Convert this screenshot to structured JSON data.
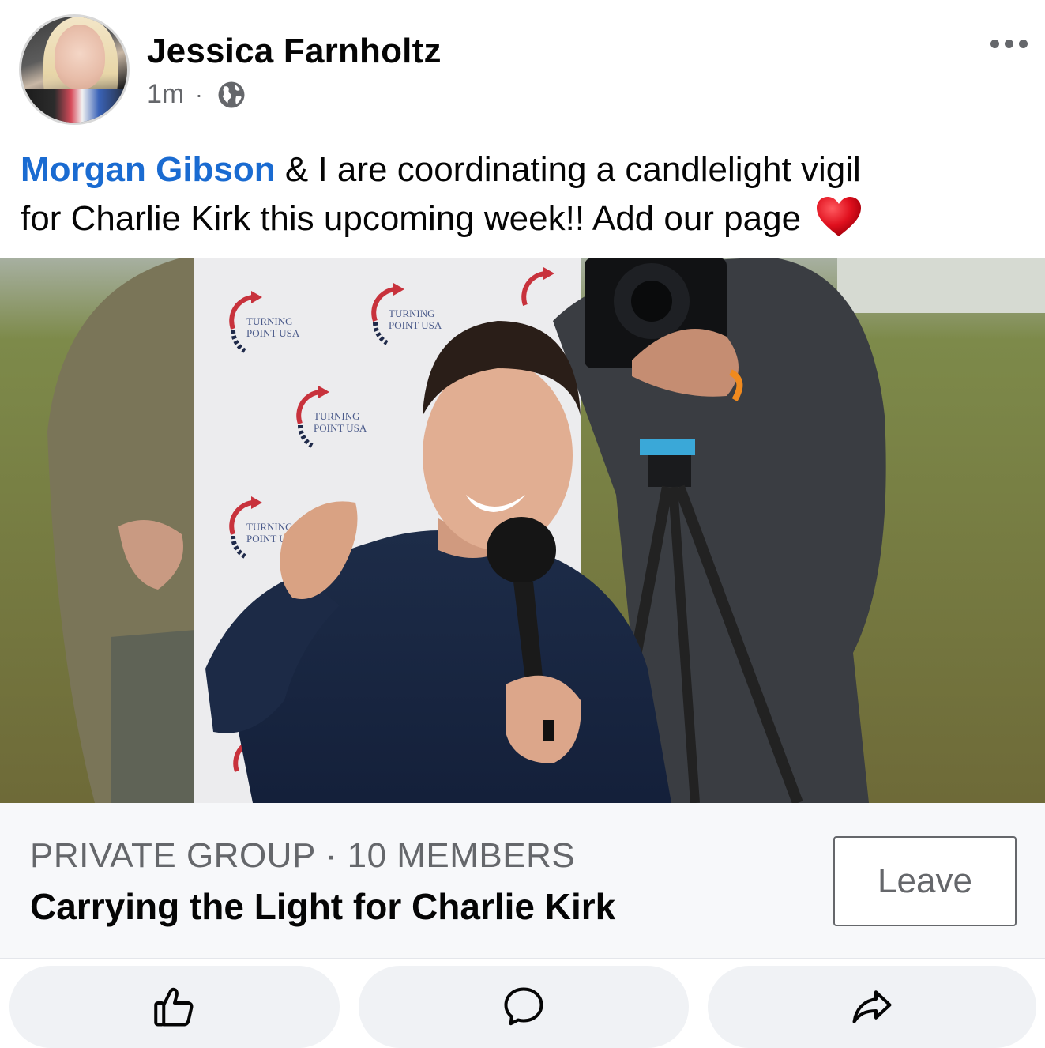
{
  "post": {
    "author": "Jessica Farnholtz",
    "timestamp": "1m",
    "separator": "·",
    "audience_icon": "globe-icon",
    "more_icon": "more-options-icon",
    "mention": "Morgan Gibson",
    "text_line1": " & I are coordinating a candlelight vigil",
    "text_line2": "for Charlie Kirk this upcoming week!! Add our page",
    "emoji": "red-heart-icon"
  },
  "photo": {
    "backdrop_brand": "TURNING POINT USA",
    "backdrop_line1": "TURNING",
    "backdrop_line2": "POINT USA"
  },
  "group": {
    "meta": "PRIVATE GROUP · 10 MEMBERS",
    "name": "Carrying the Light for Charlie Kirk",
    "leave_label": "Leave"
  },
  "actions": {
    "like_icon": "thumbs-up-icon",
    "comment_icon": "comment-bubble-icon",
    "share_icon": "share-arrow-icon"
  },
  "colors": {
    "mention": "#1a6bd1",
    "secondary_text": "#65676b",
    "action_bg": "#f0f2f5",
    "card_bg": "#f7f8fa",
    "heart": "#e0101e"
  }
}
